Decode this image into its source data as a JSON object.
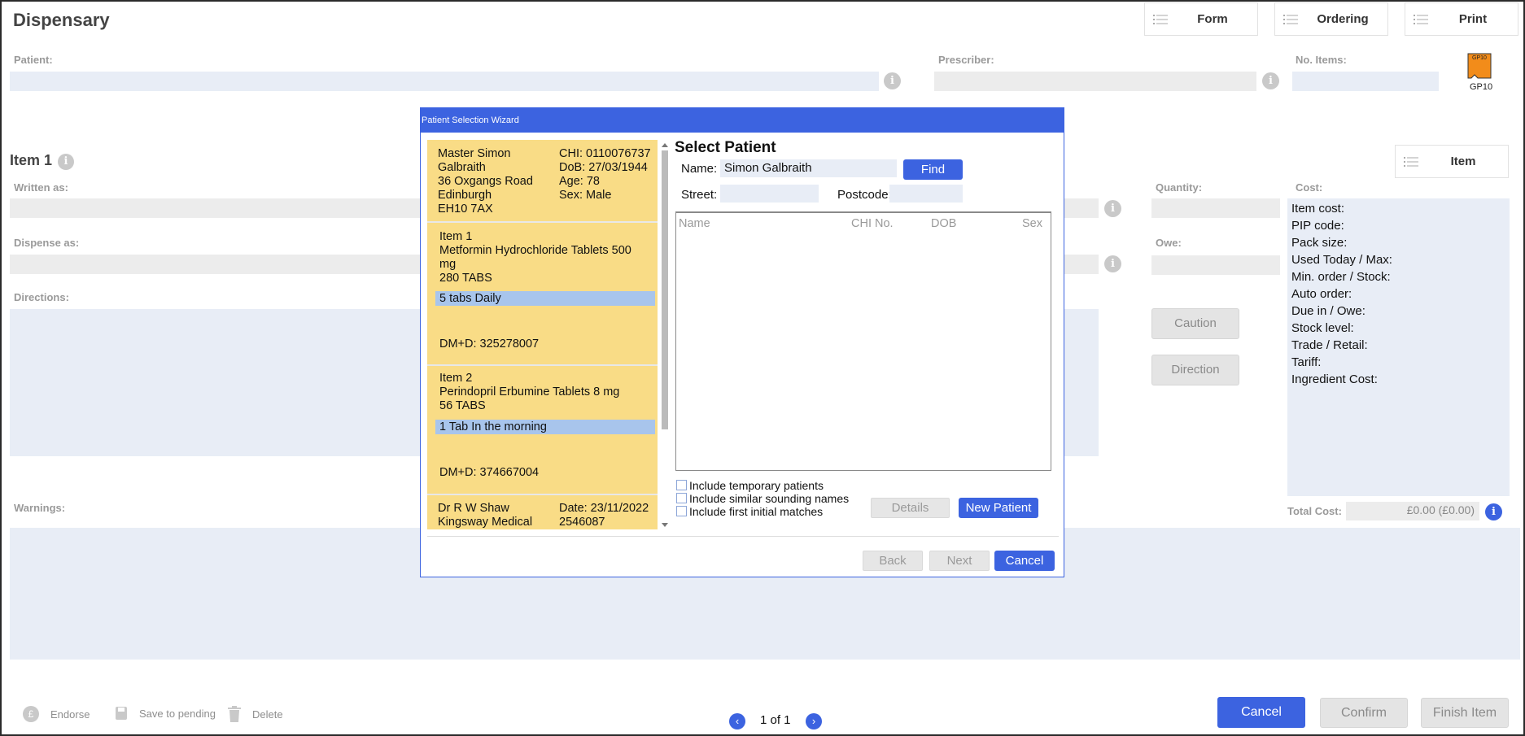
{
  "app": {
    "title": "Dispensary"
  },
  "toolbar": {
    "form": "Form",
    "ordering": "Ordering",
    "print": "Print",
    "item": "Item"
  },
  "header": {
    "patient_label": "Patient:",
    "prescriber_label": "Prescriber:",
    "no_items_label": "No. Items:",
    "gp10_label": "GP10",
    "gp10_badge": "GP10"
  },
  "item": {
    "title": "Item 1",
    "written_as": "Written as:",
    "dispense_as": "Dispense as:",
    "directions": "Directions:",
    "quantity": "Quantity:",
    "owe": "Owe:",
    "cost": "Cost:",
    "warnings": "Warnings:",
    "caution": "Caution",
    "direction": "Direction",
    "total_cost_label": "Total Cost:",
    "total_cost_value": "£0.00 (£0.00)"
  },
  "cost_lines": [
    "Item cost:",
    "PIP code:",
    "Pack size:",
    "Used Today / Max:",
    "Min. order / Stock:",
    "Auto order:",
    "Due in / Owe:",
    "Stock level:",
    "Trade / Retail:",
    "Tariff:",
    "Ingredient Cost:"
  ],
  "footer": {
    "endorse": "Endorse",
    "save_pending": "Save to pending",
    "delete": "Delete",
    "pager": "1 of 1",
    "cancel": "Cancel",
    "confirm": "Confirm",
    "finish": "Finish Item"
  },
  "wizard": {
    "title": "Patient Selection Wizard",
    "patient_card": {
      "name1": "Master Simon",
      "name2": "Galbraith",
      "addr1": "36 Oxgangs Road",
      "addr2": "Edinburgh",
      "addr3": "EH10 7AX",
      "chi": "CHI: 0110076737",
      "dob": "DoB: 27/03/1944",
      "age": "Age: 78",
      "sex": "Sex: Male"
    },
    "items": [
      {
        "heading": "Item 1",
        "drug1": "Metformin Hydrochloride  Tablets  500",
        "drug2": "mg",
        "qty": "280  TABS",
        "direction": "5 tabs Daily",
        "dmd": "DM+D: 325278007"
      },
      {
        "heading": "Item 2",
        "drug1": "Perindopril Erbumine  Tablets  8 mg",
        "drug2": "",
        "qty": "56  TABS",
        "direction": "1 Tab In the morning",
        "dmd": "DM+D: 374667004"
      }
    ],
    "prescriber_card": {
      "name": "Dr R W Shaw",
      "practice": "Kingsway Medical",
      "date": "Date: 23/11/2022",
      "code": "2546087"
    },
    "select_heading": "Select Patient",
    "name_label": "Name:",
    "name_value": "Simon Galbraith",
    "find": "Find",
    "street_label": "Street:",
    "postcode_label": "Postcode:",
    "columns": [
      "Name",
      "CHI No.",
      "DOB",
      "Sex"
    ],
    "options": [
      "Include temporary patients",
      "Include similar sounding names",
      "Include first initial matches"
    ],
    "details": "Details",
    "new_patient": "New Patient",
    "back": "Back",
    "next": "Next",
    "cancel": "Cancel"
  },
  "colors": {
    "accent": "#3c63e0",
    "card": "#f9dc86",
    "field": "#e8edf6"
  }
}
